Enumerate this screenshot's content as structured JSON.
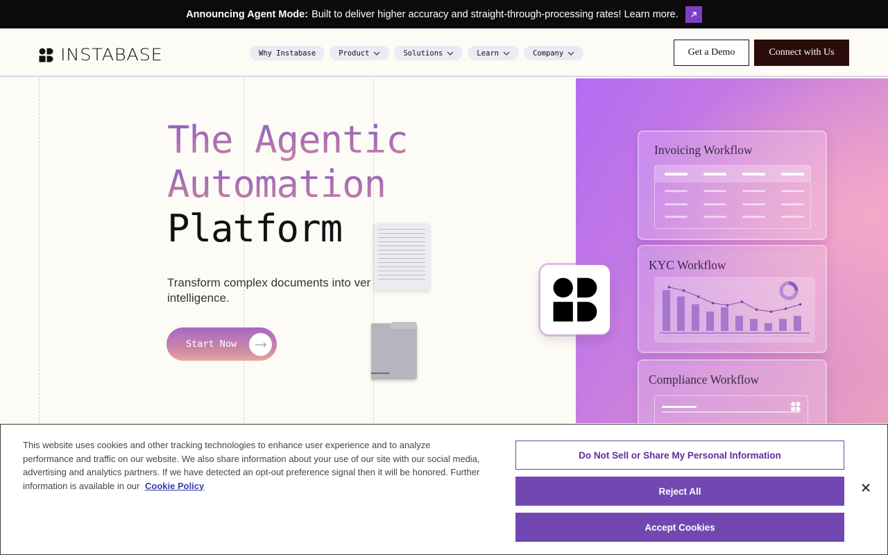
{
  "announcement": {
    "bold": "Announcing Agent Mode:",
    "text": "Built to deliver higher accuracy and straight-through-processing rates! Learn more.",
    "icon": "arrow-up-right-icon"
  },
  "header": {
    "logo_text": "INSTABASE",
    "nav": [
      {
        "label": "Why Instabase",
        "has_dropdown": false
      },
      {
        "label": "Product",
        "has_dropdown": true
      },
      {
        "label": "Solutions",
        "has_dropdown": true
      },
      {
        "label": "Learn",
        "has_dropdown": true
      },
      {
        "label": "Company",
        "has_dropdown": true
      }
    ],
    "demo_label": "Get a Demo",
    "connect_label": "Connect with Us"
  },
  "hero": {
    "title_line1": "The Agentic",
    "title_line2": "Automation",
    "title_line3": "Platform",
    "subtitle_line1": "Transform complex documents into ver",
    "subtitle_line2": "intelligence.",
    "cta_label": "Start Now"
  },
  "workflows": {
    "invoicing": "Invoicing Workflow",
    "kyc": "KYC Workflow",
    "compliance": "Compliance Workflow",
    "kyc_bars": [
      0.95,
      0.8,
      0.62,
      0.45,
      0.55,
      0.35,
      0.28,
      0.18,
      0.28,
      0.35
    ],
    "kyc_line": [
      0.92,
      0.84,
      0.7,
      0.55,
      0.5,
      0.58,
      0.4,
      0.35,
      0.42,
      0.52
    ]
  },
  "cookie": {
    "text": "This website uses cookies and other tracking technologies to enhance user experience and to analyze performance and traffic on our website. We also share information about your use of our site with our social media, advertising and analytics partners. If we have detected an opt-out preference signal then it will be honored. Further information is available in our",
    "link": "Cookie Policy",
    "do_not_sell": "Do Not Sell or Share My Personal Information",
    "reject": "Reject All",
    "accept": "Accept Cookies"
  },
  "colors": {
    "accent": "#7347b1",
    "dark_button": "#2a0d0b",
    "announcement_bg": "#0b0b0b"
  }
}
